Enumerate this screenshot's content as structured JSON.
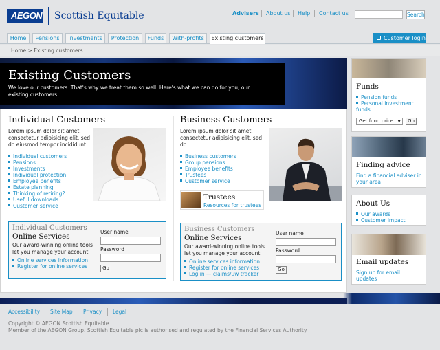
{
  "brand": {
    "logo": "AEGON",
    "name": "Scottish Equitable"
  },
  "toplinks": [
    "Advisers",
    "About us",
    "Help",
    "Contact us"
  ],
  "search": {
    "button": "Search",
    "placeholder": ""
  },
  "tabs": [
    "Home",
    "Pensions",
    "Investments",
    "Protection",
    "Funds",
    "With-profits",
    "Existing customers"
  ],
  "login": "Customer login",
  "breadcrumb": {
    "home": "Home",
    "sep": ">",
    "current": "Existing customers"
  },
  "hero": {
    "title": "Existing Customers",
    "intro": "We love our customers. That's why we treat them so well. Here's what we can do for you, our existing customers."
  },
  "individual": {
    "title": "Individual Customers",
    "lorem": "Lorem ipsum dolor sit amet, consectetur adipisicing elit, sed do eiusmod tempor incididunt.",
    "links": [
      "Individual customers",
      "Pensions",
      "Investments",
      "Individual protection",
      "Employee benefits",
      "Estate planning",
      "Thinking of retiring?",
      "Useful downloads",
      "Customer service"
    ],
    "box": {
      "sub": "Individual Customers",
      "title": "Online Services",
      "desc": "Our award-winning online tools let you manage your account.",
      "links": [
        "Online services information",
        "Register for online services"
      ],
      "user": "User name",
      "pass": "Password",
      "go": "Go"
    }
  },
  "business": {
    "title": "Business Customers",
    "lorem": "Lorem ipsum dolor sit amet, consectetur adipisicing elit, sed do.",
    "links": [
      "Business customers",
      "Group pensions",
      "Employee benefits",
      "Trustees",
      "Customer service"
    ],
    "trustees": {
      "title": "Trustees",
      "link": "Resources for trustees"
    },
    "box": {
      "sub": "Business Customers",
      "title": "Online Services",
      "desc": "Our award-winning online tools let you manage your account.",
      "links": [
        "Online services information",
        "Register for online services",
        "Log in — claims/uw tracker"
      ],
      "user": "User name",
      "pass": "Password",
      "go": "Go"
    }
  },
  "sidebar": {
    "funds": {
      "title": "Funds",
      "links": [
        "Pension funds",
        "Personal investment funds"
      ],
      "select": "Get fund price",
      "go": "Go"
    },
    "advice": {
      "title": "Finding advice",
      "link": "Find a financial adviser in your area"
    },
    "about": {
      "title": "About Us",
      "links": [
        "Our awards",
        "Customer impact"
      ]
    },
    "email": {
      "title": "Email updates",
      "link": "Sign up for email updates"
    }
  },
  "footer": {
    "links": [
      "Accessibility",
      "Site Map",
      "Privacy",
      "Legal"
    ],
    "copy1": "Copyright © AEGON Scottish Equitable.",
    "copy2": "Member of the AEGON Group. Scottish Equitable plc is authorised and regulated by the Financial Services Authority."
  }
}
